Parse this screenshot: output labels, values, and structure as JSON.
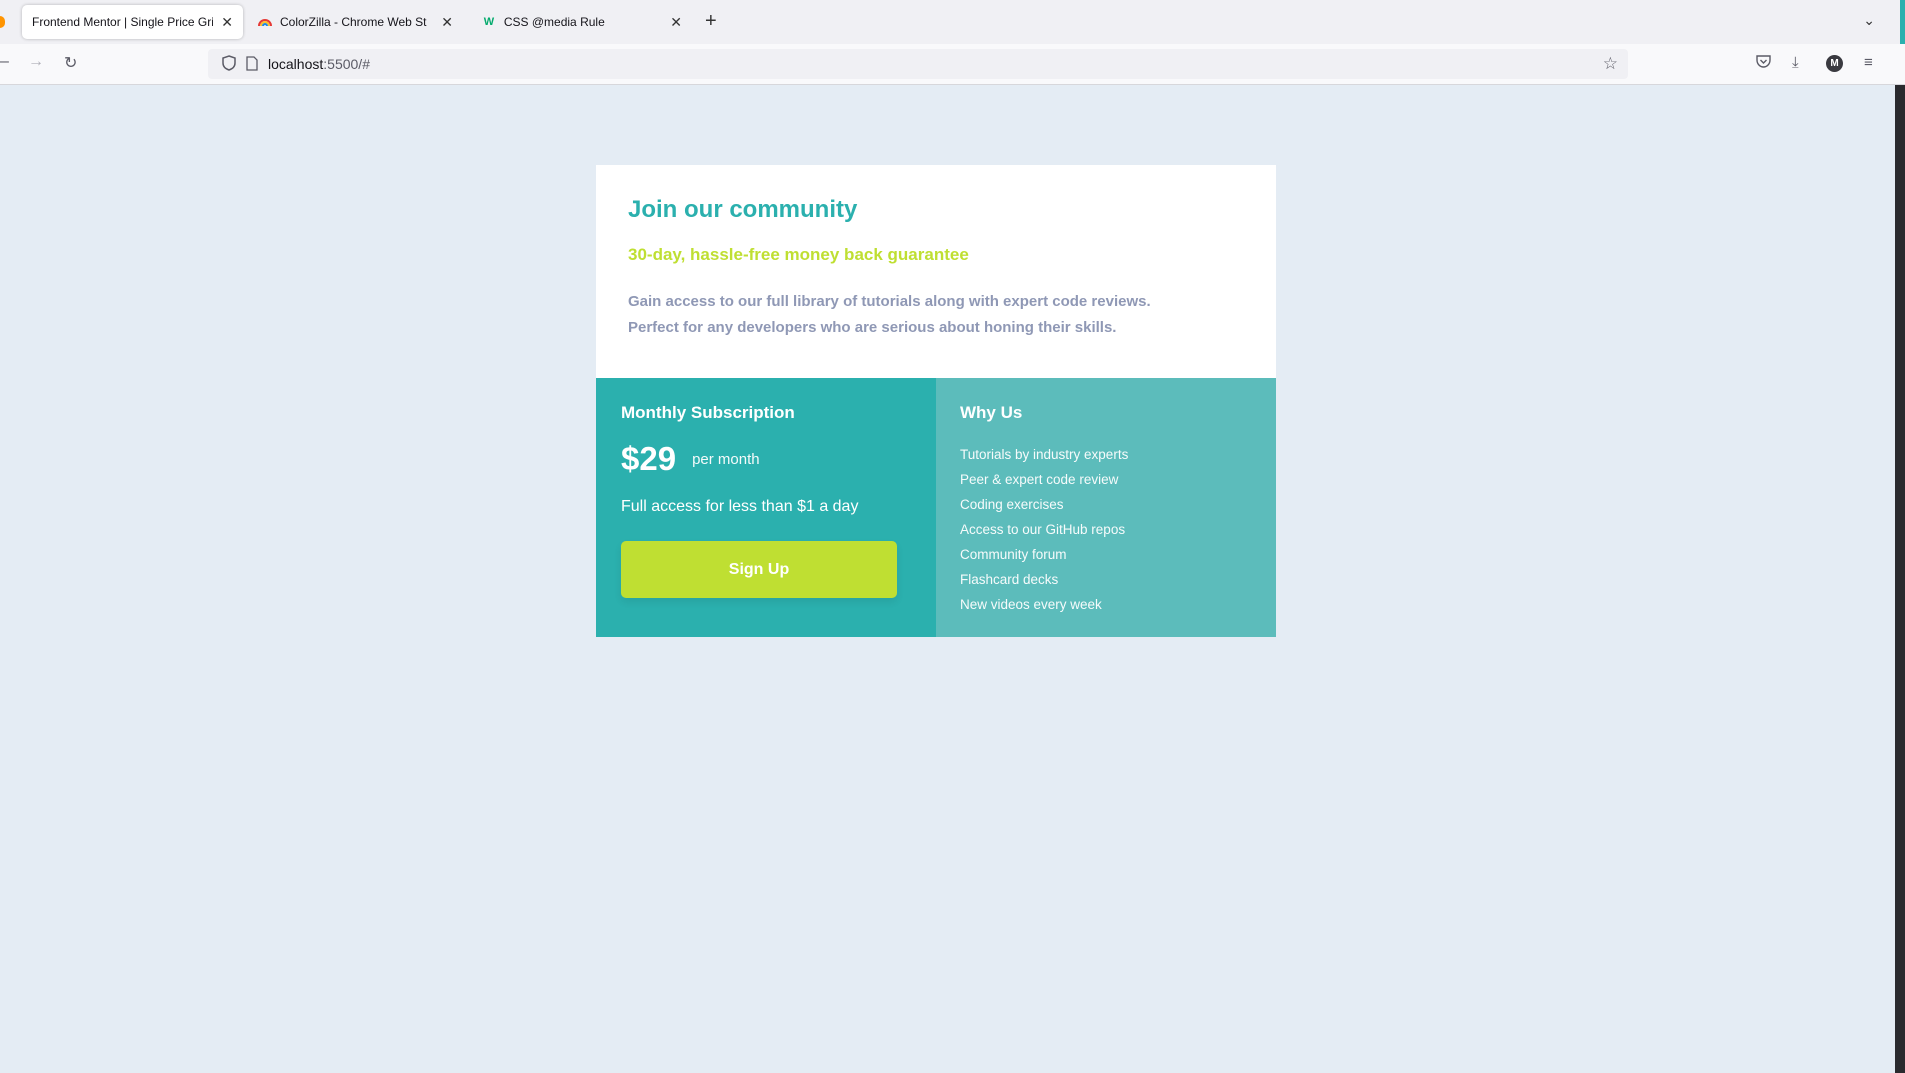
{
  "browser": {
    "tabs": [
      {
        "label": "Frontend Mentor | Single Price Grid",
        "active": true
      },
      {
        "label": "ColorZilla - Chrome Web Store",
        "active": false
      },
      {
        "label": "CSS @media Rule",
        "active": false
      }
    ],
    "url": {
      "host": "localhost",
      "rest": ":5500/#"
    }
  },
  "card": {
    "title": "Join our community",
    "subtitle": "30-day, hassle-free money back guarantee",
    "description_line1": "Gain access to our full library of tutorials along with expert code reviews.",
    "description_line2": "Perfect for any developers who are serious about honing their skills.",
    "subscription": {
      "title": "Monthly Subscription",
      "price": "$29",
      "period": "per month",
      "access_text": "Full access for less than $1 a day",
      "button_label": "Sign Up"
    },
    "why_us": {
      "title": "Why Us",
      "items": [
        "Tutorials by industry experts",
        "Peer & expert code review",
        "Coding exercises",
        "Access to our GitHub repos",
        "Community forum",
        "Flashcard decks",
        "New videos every week"
      ]
    }
  },
  "colors": {
    "page_background": "#e4ecf4",
    "primary_teal": "#2bb0ae",
    "light_teal": "#5cbcbb",
    "lime": "#bfdf32",
    "grayish_blue": "#8f98b5"
  }
}
